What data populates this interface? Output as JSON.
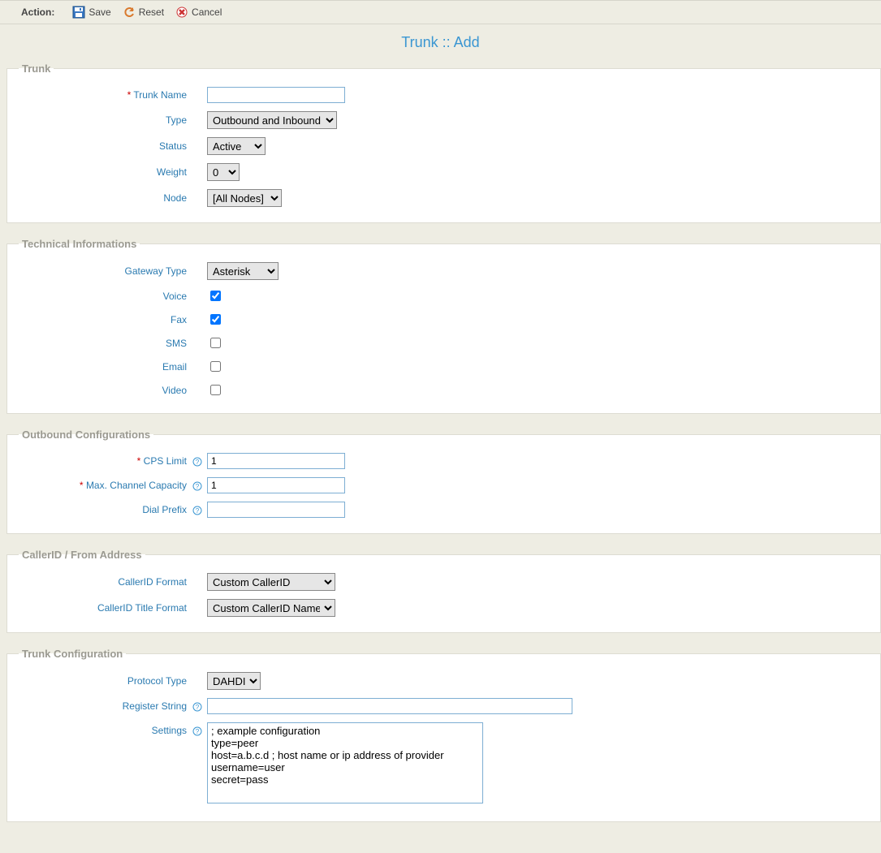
{
  "toolbar": {
    "action_label": "Action:",
    "save": "Save",
    "reset": "Reset",
    "cancel": "Cancel"
  },
  "page_title": "Trunk :: Add",
  "trunk": {
    "legend": "Trunk",
    "name_label": "Trunk Name",
    "name_value": "",
    "type_label": "Type",
    "type_value": "Outbound and Inbound",
    "status_label": "Status",
    "status_value": "Active",
    "weight_label": "Weight",
    "weight_value": "0",
    "node_label": "Node",
    "node_value": "[All Nodes]"
  },
  "tech": {
    "legend": "Technical Informations",
    "gateway_label": "Gateway Type",
    "gateway_value": "Asterisk",
    "voice_label": "Voice",
    "fax_label": "Fax",
    "sms_label": "SMS",
    "email_label": "Email",
    "video_label": "Video"
  },
  "outbound": {
    "legend": "Outbound Configurations",
    "cps_label": "CPS Limit",
    "cps_value": "1",
    "max_label": "Max. Channel Capacity",
    "max_value": "1",
    "dial_label": "Dial Prefix",
    "dial_value": ""
  },
  "callerid": {
    "legend": "CallerID / From Address",
    "format_label": "CallerID Format",
    "format_value": "Custom CallerID",
    "title_label": "CallerID Title Format",
    "title_value": "Custom CallerID Name"
  },
  "trunkconf": {
    "legend": "Trunk Configuration",
    "protocol_label": "Protocol Type",
    "protocol_value": "DAHDI",
    "register_label": "Register String",
    "register_value": "",
    "settings_label": "Settings",
    "settings_value": "; example configuration\ntype=peer\nhost=a.b.c.d ; host name or ip address of provider\nusername=user\nsecret=pass"
  }
}
